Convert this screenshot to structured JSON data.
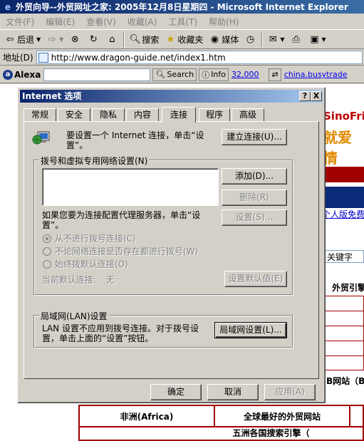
{
  "browser": {
    "title": "外贸向导--外贸网址之家: 2005年12月8日星期四 - Microsoft Internet Explorer",
    "menu": [
      "文件(F)",
      "编辑(E)",
      "查看(V)",
      "收藏(A)",
      "工具(T)",
      "帮助(H)"
    ],
    "toolbar": {
      "back": "后退",
      "search": "搜索",
      "favorites": "收藏夹",
      "media": "媒体"
    },
    "address": {
      "label": "地址(D)",
      "url": "http://www.dragon-guide.net/index1.htm"
    },
    "alexa": {
      "logo": "Alexa",
      "search_button": "Search",
      "info_button": "Info",
      "rank": "32,000",
      "site": "china.busytrade"
    }
  },
  "webpage": {
    "brand": "SinoFri",
    "slogan": "就爱情",
    "link": "个人版免费",
    "keyword_box": "关键字",
    "header_right": "外贸引擎",
    "row_label": "B网站（B",
    "table": {
      "cell1": "非洲(Africa)",
      "cell2": "全球最好的外贸网站",
      "cell3": "五洲各国搜索引擎（"
    }
  },
  "dialog": {
    "title": "Internet 选项",
    "help_btn": "?",
    "close_btn": "X",
    "tabs": [
      "常规",
      "安全",
      "隐私",
      "内容",
      "连接",
      "程序",
      "高级"
    ],
    "active_tab": "连接",
    "setup_text": "要设置一个 Internet 连接，单击“设置”。",
    "setup_button": "建立连接(U)...",
    "dialup_group": "拨号和虚拟专用网络设置(N)",
    "add_button": "添加(D)...",
    "remove_button": "删除(R)",
    "settings_button": "设置(S)...",
    "proxy_text": "如果您要为连接配置代理服务器，单击“设置”。",
    "radio1": "从不进行拨号连接(C)",
    "radio2": "不论网络连接是否存在都进行拨号(W)",
    "radio3": "始终拨默认连接(O)",
    "current_default_label": "当前默认连接:",
    "current_default_value": "无",
    "set_default_button": "设置默认值(E)",
    "lan_group": "局域网(LAN)设置",
    "lan_text": "LAN 设置不应用到拨号连接。对于拨号设置，单击上面的“设置”按钮。",
    "lan_button": "局域网设置(L)...",
    "ok": "确定",
    "cancel": "取消",
    "apply": "应用(A)"
  }
}
